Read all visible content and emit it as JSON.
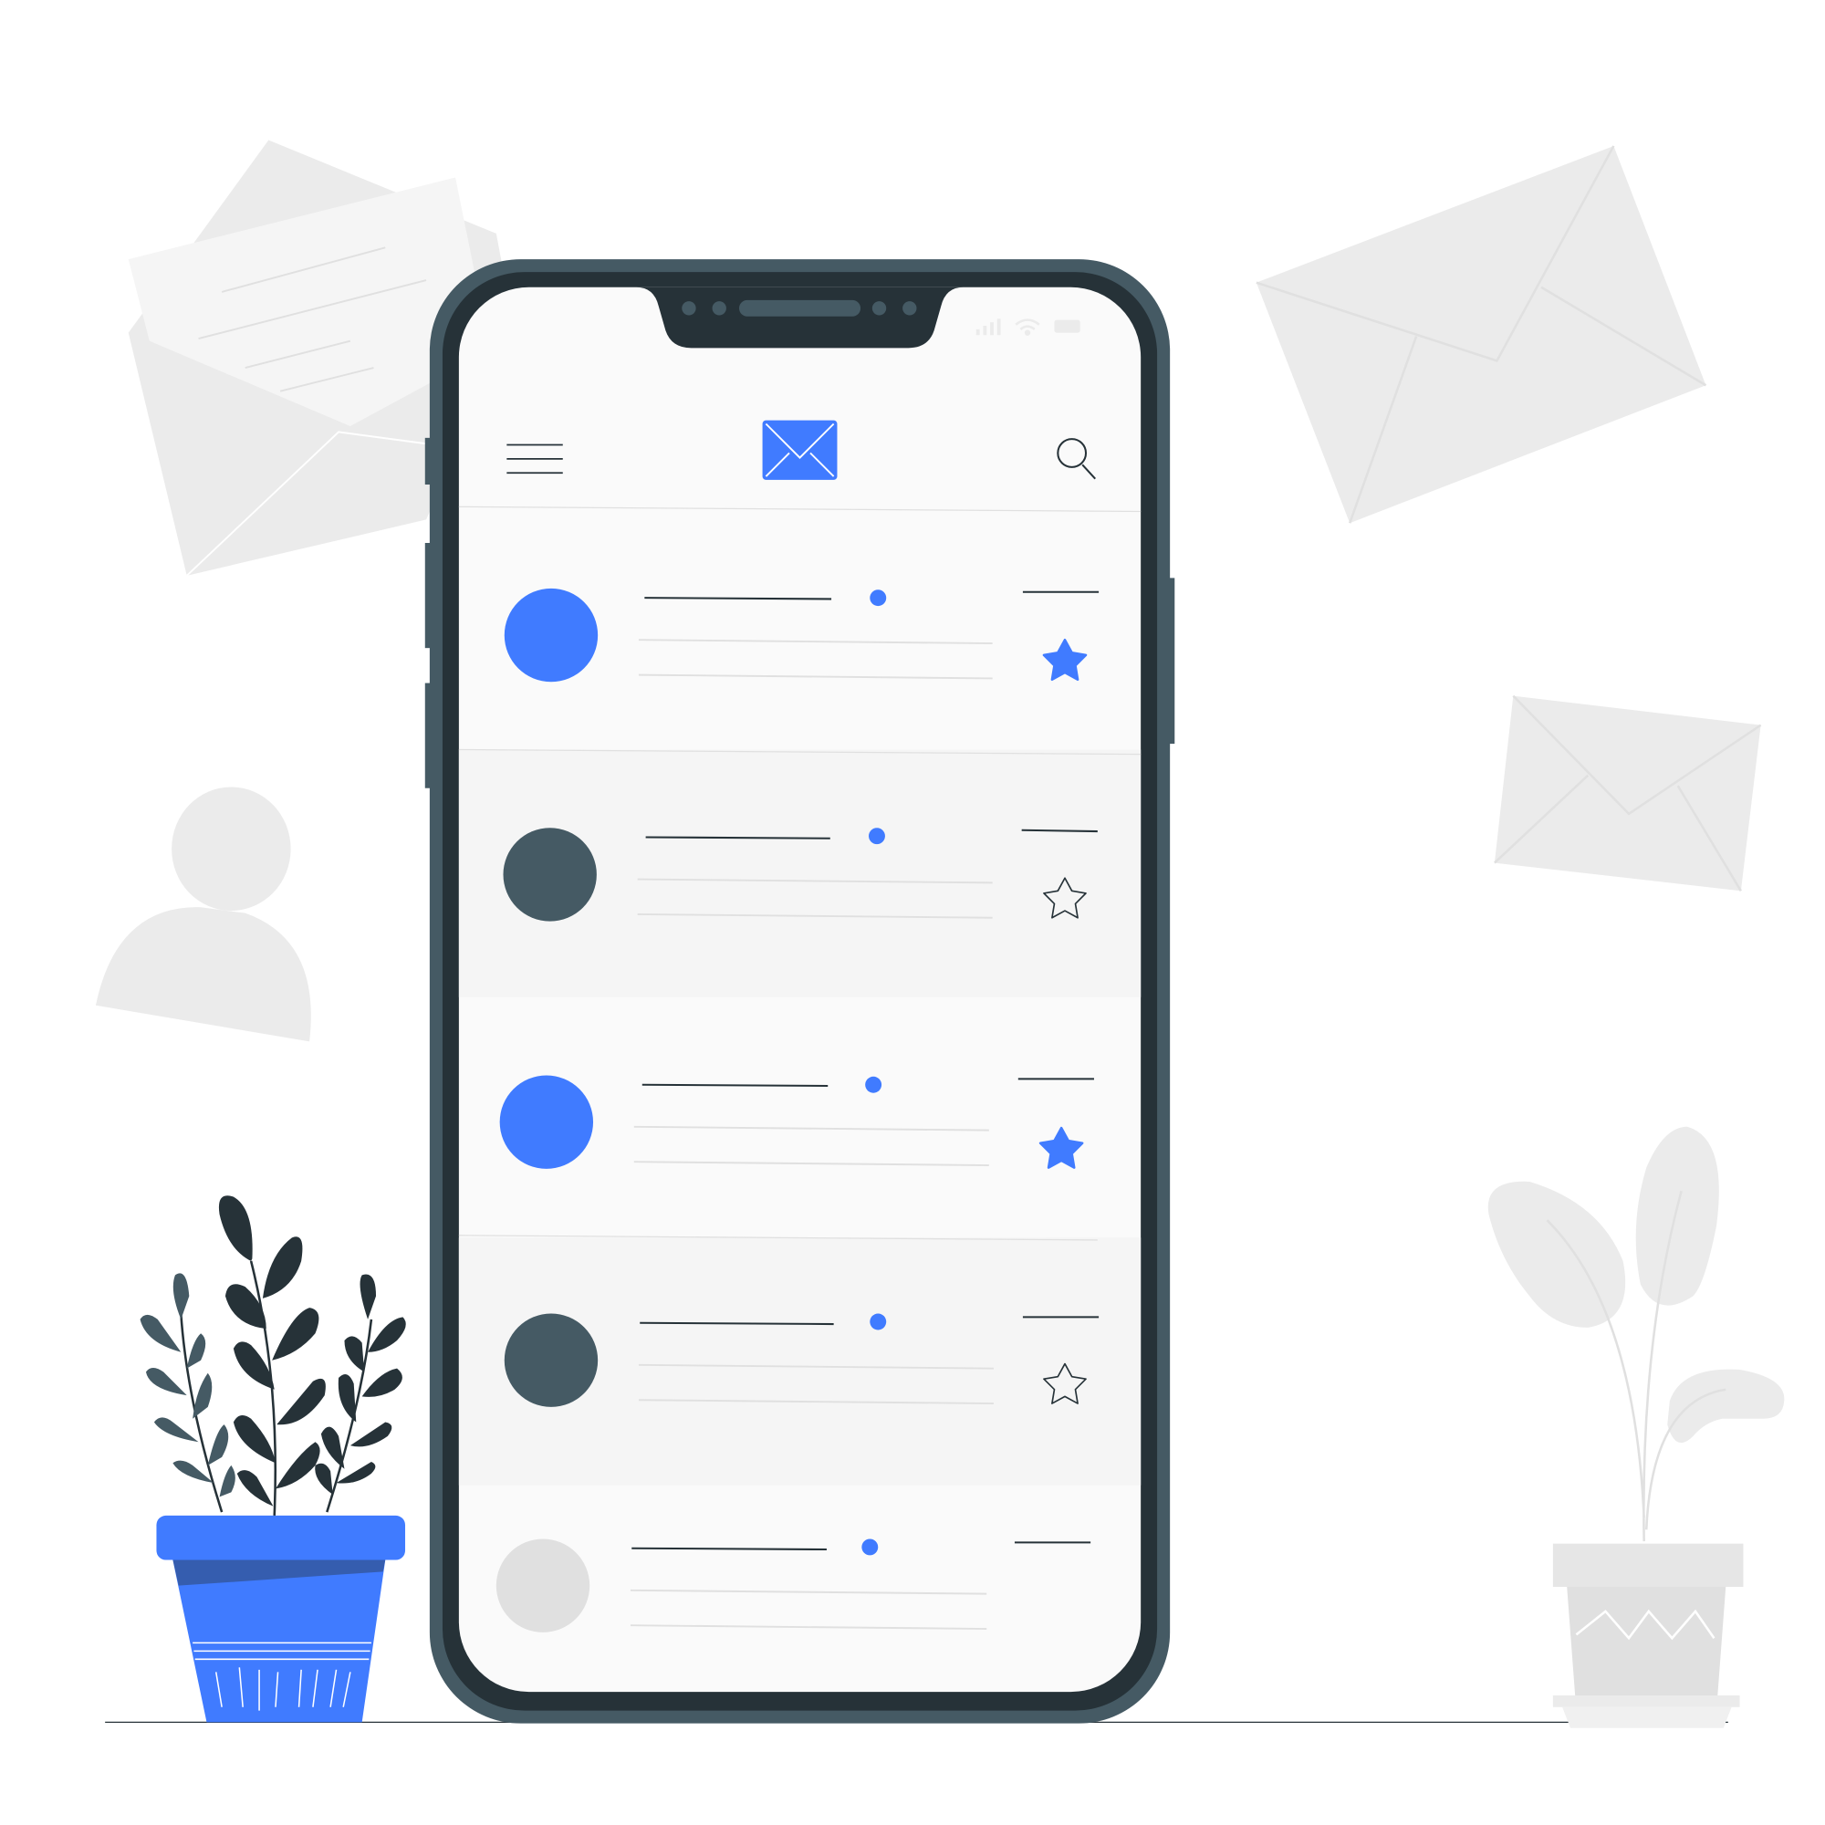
{
  "colors": {
    "accent": "#407BFF",
    "phone_frame": "#455A64",
    "phone_bezel": "#263238",
    "screen_bg": "#FAFAFA",
    "row_alt_bg": "#F5F5F5",
    "background_shapes": "#EBEBEB",
    "unread_avatar": "#407BFF",
    "read_avatar": "#455A64",
    "placeholder_avatar": "#E0E0E0"
  },
  "app_header": {
    "menu_icon": "hamburger-menu-icon",
    "logo_icon": "envelope-icon",
    "search_icon": "magnifier-icon"
  },
  "status_bar": {
    "icons": [
      "signal-icon",
      "wifi-icon",
      "battery-icon"
    ]
  },
  "inbox": {
    "messages": [
      {
        "avatar": "blue",
        "starred": true,
        "unread": true
      },
      {
        "avatar": "dark",
        "starred": false,
        "unread": true
      },
      {
        "avatar": "blue",
        "starred": true,
        "unread": true
      },
      {
        "avatar": "dark",
        "starred": false,
        "unread": true
      },
      {
        "avatar": "grey",
        "starred": false,
        "unread": true
      }
    ]
  },
  "decorations": [
    "open-envelope",
    "envelope-large",
    "envelope-small",
    "user-silhouette",
    "potted-plant-blue",
    "potted-plant-grey"
  ]
}
